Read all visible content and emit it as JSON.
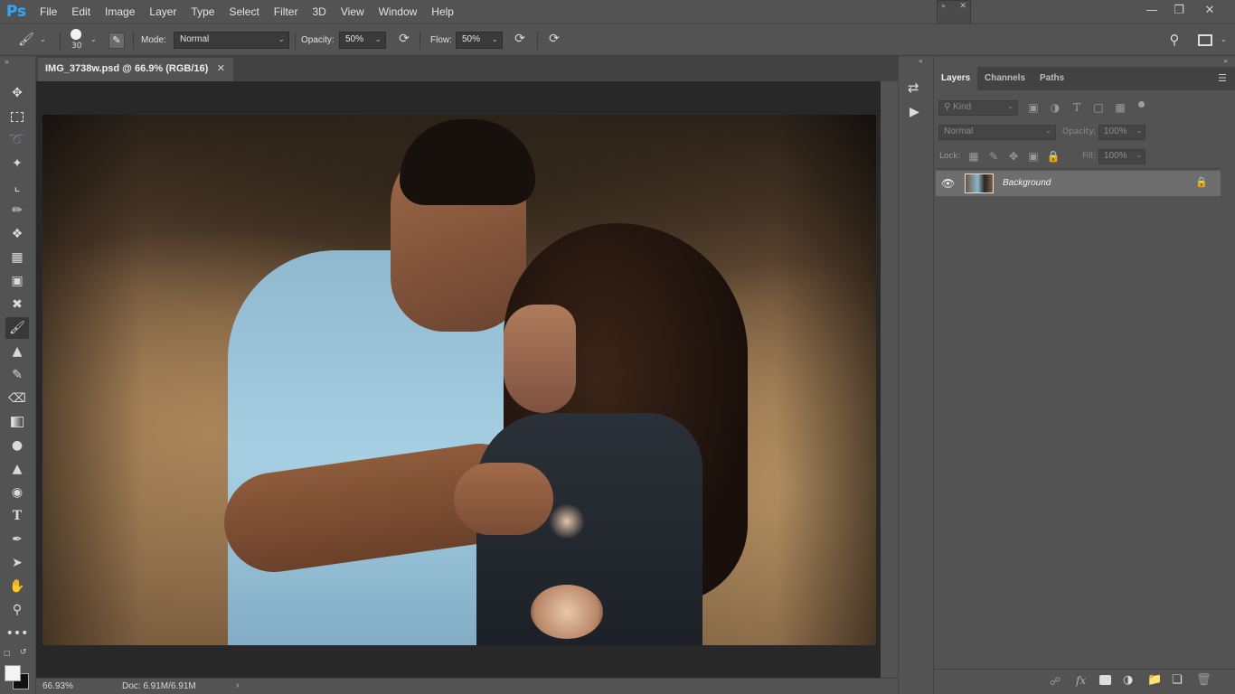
{
  "app": {
    "logo": "Ps"
  },
  "menu": [
    "File",
    "Edit",
    "Image",
    "Layer",
    "Type",
    "Select",
    "Filter",
    "3D",
    "View",
    "Window",
    "Help"
  ],
  "options": {
    "brush_size": "30",
    "mode_label": "Mode:",
    "mode_value": "Normal",
    "opacity_label": "Opacity:",
    "opacity_value": "50%",
    "flow_label": "Flow:",
    "flow_value": "50%"
  },
  "document": {
    "tab_title": "IMG_3738w.psd @ 66.9% (RGB/16)",
    "zoom": "66.93%",
    "doc_size": "Doc: 6.91M/6.91M"
  },
  "panel": {
    "tabs": [
      "Layers",
      "Channels",
      "Paths"
    ],
    "active_tab": "Layers",
    "filter_kind": "Kind",
    "blend_mode": "Normal",
    "opacity_label": "Opacity:",
    "opacity_value": "100%",
    "lock_label": "Lock:",
    "fill_label": "Fill:",
    "fill_value": "100%",
    "layers": [
      {
        "name": "Background",
        "visible": true,
        "locked": true
      }
    ]
  },
  "colors": {
    "chrome": "#535353",
    "canvas_bg": "#282828",
    "accent": "#31a8ff",
    "selected_layer": "#6e6e6e"
  },
  "icons": {
    "tools": [
      "move-icon",
      "marquee-icon",
      "lasso-icon",
      "magic-wand-icon",
      "crop-icon",
      "eyedropper-icon",
      "healing-brush-icon",
      "patch-icon",
      "frame-icon",
      "content-aware-move-icon",
      "brush-icon",
      "clone-stamp-icon",
      "history-brush-icon",
      "eraser-icon",
      "gradient-icon",
      "blur-icon",
      "sharpen-icon",
      "dodge-icon",
      "type-icon",
      "pen-icon",
      "path-selection-icon",
      "hand-icon",
      "zoom-icon",
      "more-tools-icon"
    ]
  }
}
